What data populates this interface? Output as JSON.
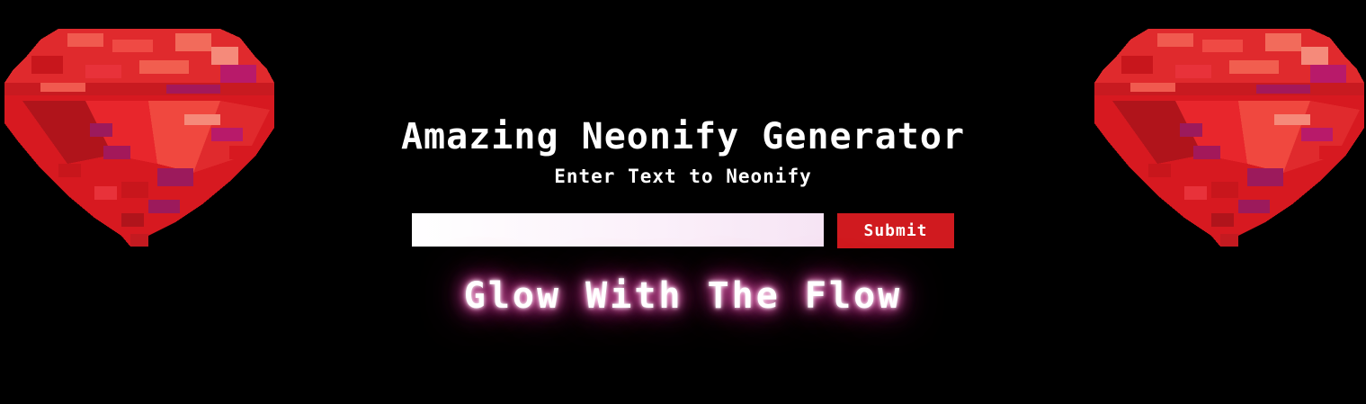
{
  "header": {
    "title": "Amazing Neonify Generator",
    "subtitle": "Enter Text to Neonify"
  },
  "form": {
    "input_value": "",
    "input_placeholder": "",
    "submit_label": "Submit"
  },
  "output": {
    "neon_text": "Glow With The Flow"
  },
  "decorations": {
    "left_image": "ruby-gem",
    "right_image": "ruby-gem"
  },
  "colors": {
    "background": "#000000",
    "submit_button": "#d01a1f",
    "neon_glow": "#ff4fb8"
  }
}
